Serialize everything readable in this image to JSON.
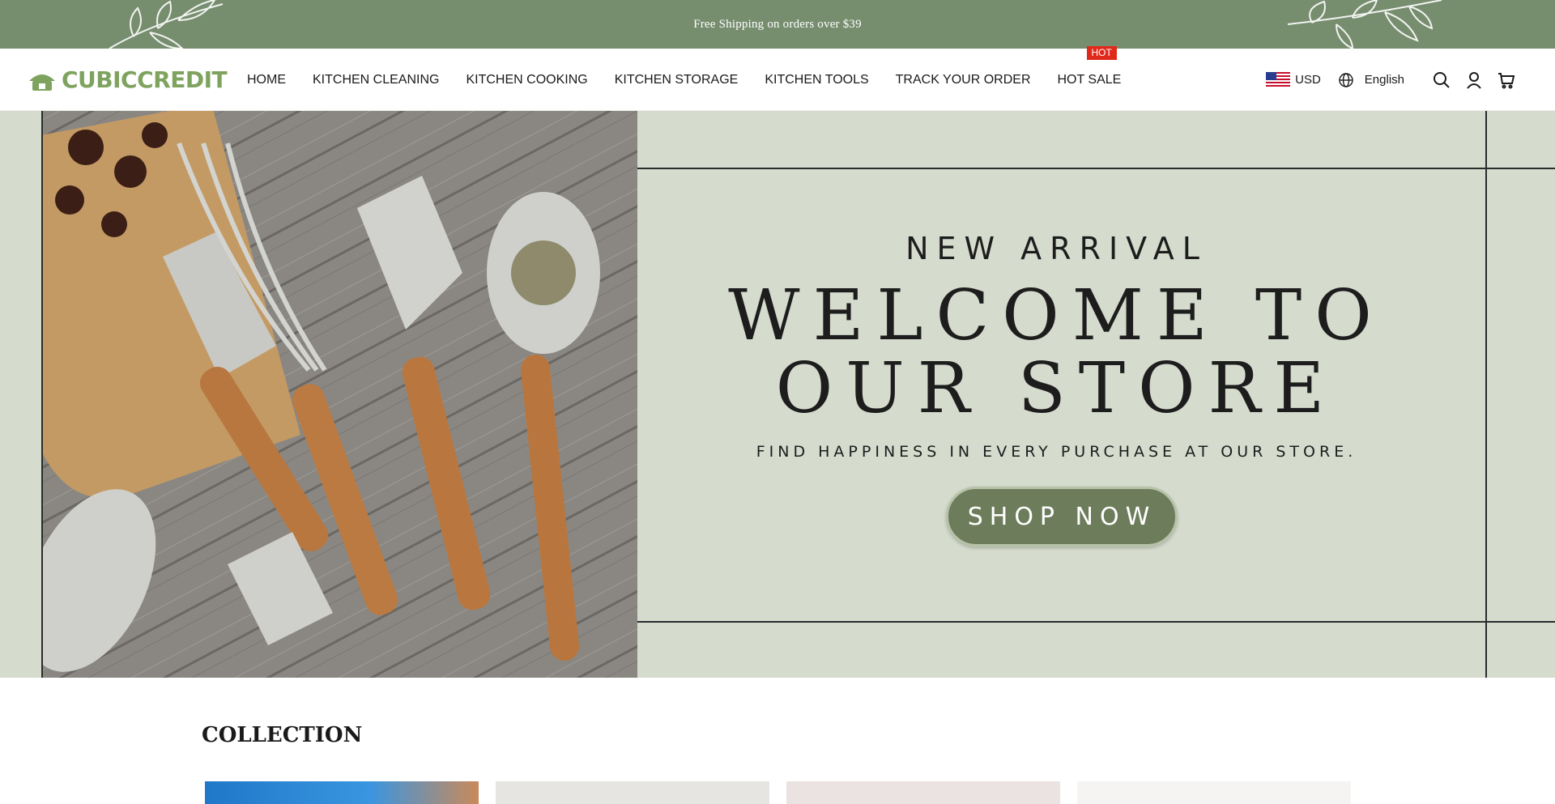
{
  "announcement": {
    "text": "Free Shipping on orders over $39"
  },
  "header": {
    "logo_text": "CUBICCREDIT",
    "nav": [
      {
        "label": "HOME"
      },
      {
        "label": "KITCHEN CLEANING"
      },
      {
        "label": "KITCHEN COOKING"
      },
      {
        "label": "KITCHEN STORAGE"
      },
      {
        "label": "KITCHEN TOOLS"
      },
      {
        "label": "TRACK YOUR ORDER"
      },
      {
        "label": "HOT SALE",
        "badge": "HOT"
      }
    ],
    "currency": "USD",
    "language": "English",
    "icons": [
      "globe-icon",
      "search-icon",
      "account-icon",
      "cart-icon"
    ]
  },
  "hero": {
    "kicker": "NEW ARRIVAL",
    "headline_line1": "WELCOME TO",
    "headline_line2": "OUR STORE",
    "tagline": "FIND HAPPINESS IN EVERY PURCHASE AT OUR STORE.",
    "cta": "SHOP NOW"
  },
  "collection": {
    "title": "COLLECTION"
  },
  "colors": {
    "announcement_bg": "#768d6e",
    "logo_green": "#7ea35f",
    "hero_bg": "#d5dbcd",
    "cta_bg": "#6d7c5a",
    "hot_badge": "#e0291b"
  }
}
